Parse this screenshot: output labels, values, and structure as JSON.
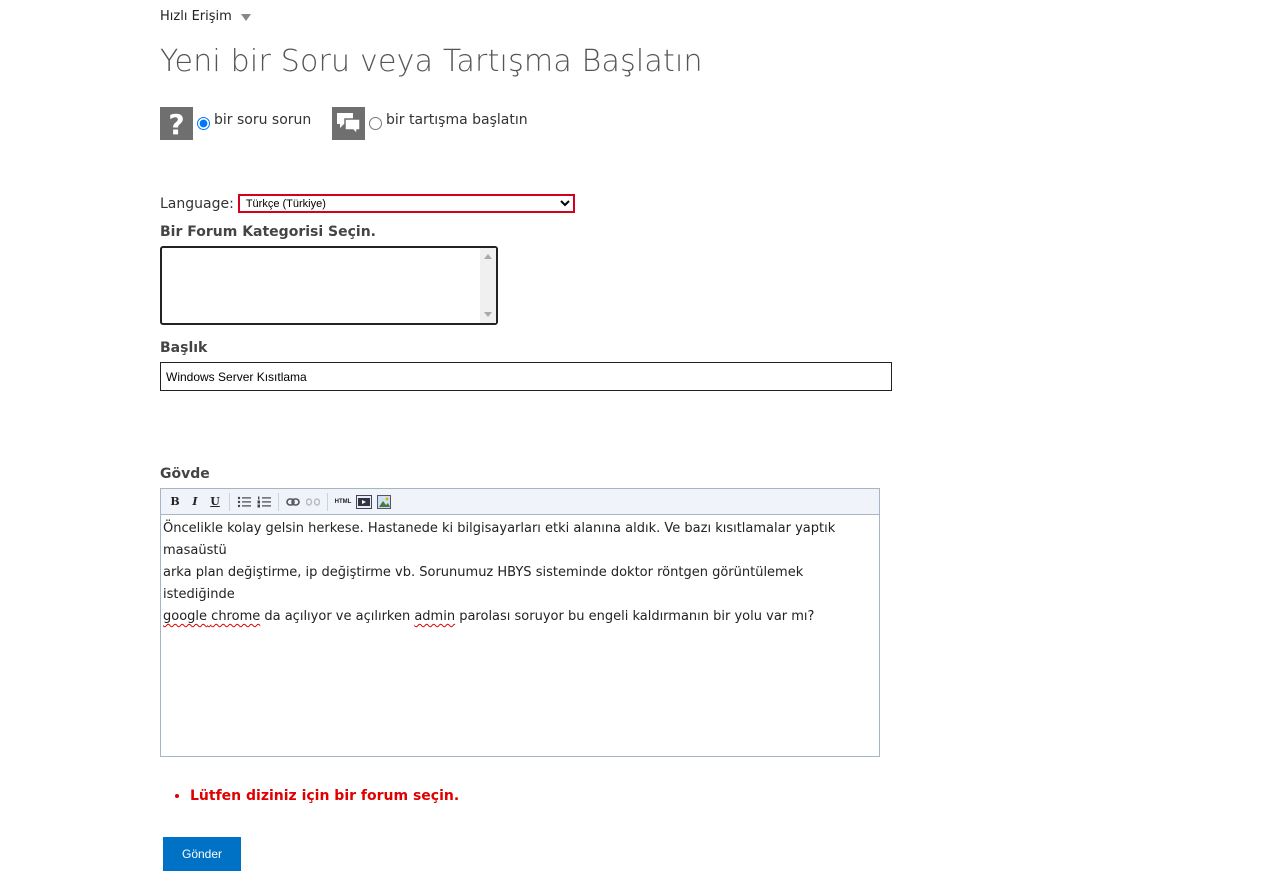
{
  "header": {
    "quick_access": "Hızlı Erişim",
    "page_title": "Yeni bir Soru veya Tartışma Başlatın"
  },
  "post_type": {
    "question_label": "bir soru sorun",
    "discussion_label": "bir tartışma başlatın",
    "selected": "question"
  },
  "language": {
    "label": "Language:",
    "selected": "Türkçe (Türkiye)"
  },
  "category": {
    "label": "Bir Forum Kategorisi Seçin."
  },
  "title_field": {
    "label": "Başlık",
    "value": "Windows Server Kısıtlama"
  },
  "body_field": {
    "label": "Gövde",
    "text_line1": "Öncelikle kolay gelsin herkese. Hastanede ki bilgisayarları etki alanına aldık. Ve bazı kısıtlamalar yaptık masaüstü",
    "text_line2": "arka plan değiştirme, ip değiştirme vb. Sorunumuz HBYS sisteminde doktor röntgen görüntülemek istediğinde",
    "text_line3_a": "google",
    "text_line3_b": " ",
    "text_line3_c": "chrome",
    "text_line3_d": " da açılıyor ve açılırken ",
    "text_line3_e": "admin",
    "text_line3_f": " parolası soruyor bu engeli kaldırmanın bir yolu var mı?"
  },
  "toolbar": {
    "bold": "B",
    "italic": "I",
    "underline": "U",
    "html": "HTML"
  },
  "validation": {
    "error": "Lütfen diziniz için bir forum seçin."
  },
  "submit": {
    "label": "Gönder"
  },
  "colors": {
    "accent": "#0072c6",
    "error": "#e00000",
    "icon_bg": "#6f6f6f"
  }
}
